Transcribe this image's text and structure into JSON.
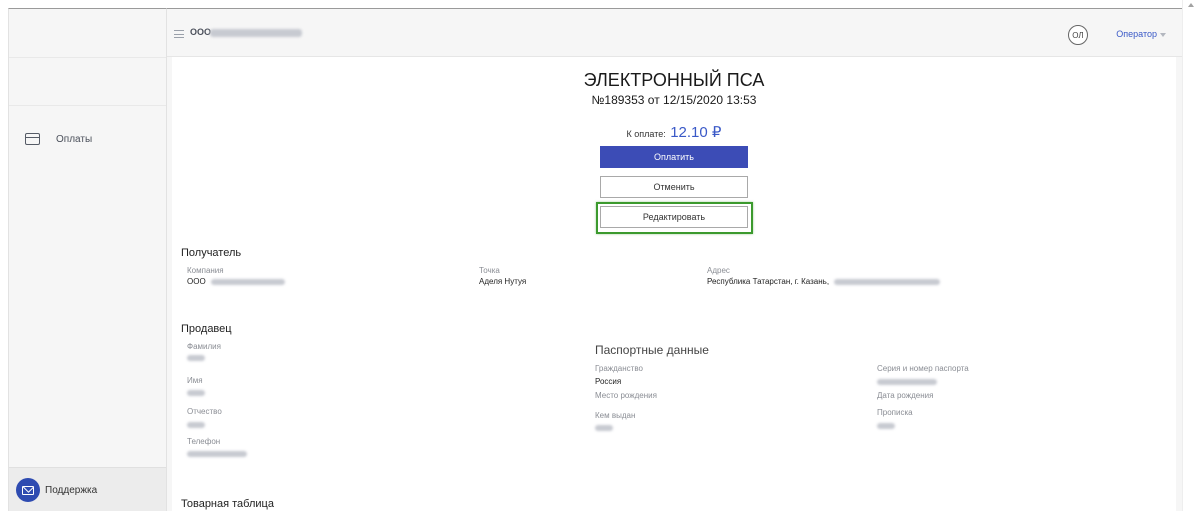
{
  "sidebar": {
    "items": [
      {
        "label": "Оплаты",
        "icon": "card-icon"
      }
    ],
    "support": {
      "label": "Поддержка",
      "icon": "mail-icon",
      "color": "#2e4bb1"
    }
  },
  "header": {
    "company_prefix": "ООО",
    "avatar_initials": "ОЛ",
    "user_role": "Оператор"
  },
  "document": {
    "title": "ЭЛЕКТРОННЫЙ ПСА",
    "number": "№189353 от 12/15/2020 13:53",
    "pay_label": "К оплате:",
    "pay_amount": "12.10 ₽",
    "buttons": {
      "pay": "Оплатить",
      "cancel": "Отменить",
      "edit": "Редактировать"
    }
  },
  "recipient": {
    "title": "Получатель",
    "company_label": "Компания",
    "company_value": "ООО",
    "point_label": "Точка",
    "point_value": "Аделя Нутуя",
    "address_label": "Адрес",
    "address_value": "Республика Татарстан, г. Казань,"
  },
  "seller": {
    "title": "Продавец",
    "surname_label": "Фамилия",
    "name_label": "Имя",
    "patronymic_label": "Отчество",
    "phone_label": "Телефон",
    "passport": {
      "title": "Паспортные данные",
      "citizenship_label": "Гражданство",
      "citizenship_value": "Россия",
      "birthplace_label": "Место рождения",
      "issued_by_label": "Кем выдан",
      "series_number_label": "Серия и номер паспорта",
      "birthdate_label": "Дата рождения",
      "registration_label": "Прописка"
    }
  },
  "goods_table": {
    "title": "Товарная таблица"
  },
  "colors": {
    "accent": "#3a59c7",
    "primary_button": "#3c4cb6",
    "highlight": "#3c9a2e"
  }
}
